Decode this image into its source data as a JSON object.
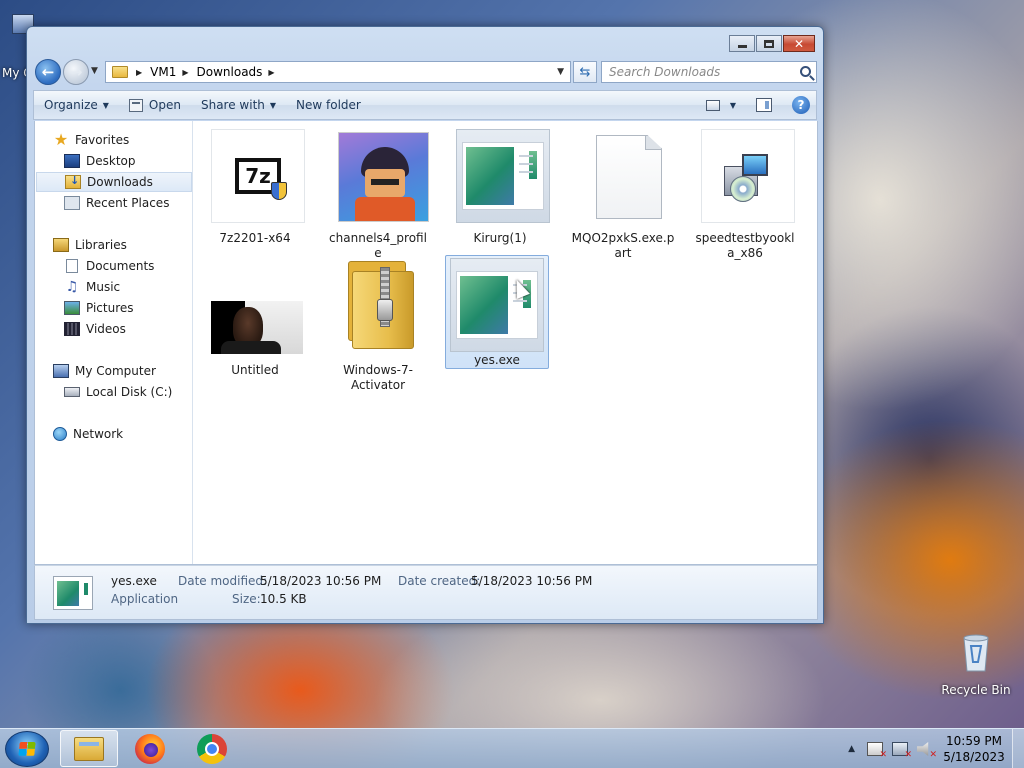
{
  "desktop": {
    "my_computer_label": "My C",
    "recycle_bin_label": "Recycle Bin"
  },
  "window": {
    "address": {
      "crumbs": [
        "VM1",
        "Downloads"
      ]
    },
    "search": {
      "placeholder": "Search Downloads"
    },
    "toolbar": {
      "organize_label": "Organize",
      "open_label": "Open",
      "share_label": "Share with",
      "new_folder_label": "New folder"
    },
    "nav_pane": {
      "favorites": "Favorites",
      "desktop": "Desktop",
      "downloads": "Downloads",
      "recent_places": "Recent Places",
      "libraries": "Libraries",
      "documents": "Documents",
      "music": "Music",
      "pictures": "Pictures",
      "videos": "Videos",
      "my_computer": "My Computer",
      "local_disk": "Local Disk (C:)",
      "network": "Network"
    },
    "files": [
      {
        "name": "7z2201-x64",
        "icon": "7zip-installer-icon"
      },
      {
        "name": "channels4_profile",
        "icon": "image-thumbnail"
      },
      {
        "name": "Kirurg(1)",
        "icon": "application-window-icon"
      },
      {
        "name": "MQO2pxkS.exe.part",
        "icon": "blank-file-icon"
      },
      {
        "name": "speedtestbyookla_x86",
        "icon": "setup-installer-icon"
      },
      {
        "name": "Untitled",
        "icon": "image-thumbnail"
      },
      {
        "name": "Windows-7-Activator",
        "icon": "zip-folder-icon"
      },
      {
        "name": "yes.exe",
        "icon": "application-window-icon",
        "selected": true
      }
    ],
    "details": {
      "name": "yes.exe",
      "type": "Application",
      "modified_label": "Date modified:",
      "modified_value": "5/18/2023 10:56 PM",
      "size_label": "Size:",
      "size_value": "10.5 KB",
      "created_label": "Date created:",
      "created_value": "5/18/2023 10:56 PM"
    }
  },
  "taskbar": {
    "time": "10:59 PM",
    "date": "5/18/2023"
  }
}
